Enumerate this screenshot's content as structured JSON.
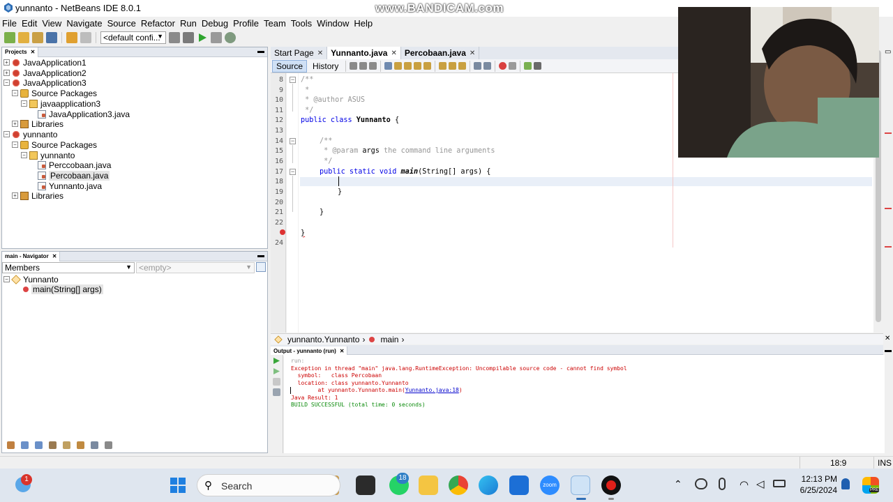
{
  "window": {
    "title": "yunnanto - NetBeans IDE 8.0.1",
    "watermark": "www.BANDICAM.com"
  },
  "menu": [
    "File",
    "Edit",
    "View",
    "Navigate",
    "Source",
    "Refactor",
    "Run",
    "Debug",
    "Profile",
    "Team",
    "Tools",
    "Window",
    "Help"
  ],
  "toolbar": {
    "config": "<default confi..."
  },
  "projects": {
    "tab": "Projects",
    "tree": [
      {
        "label": "JavaApplication1"
      },
      {
        "label": "JavaApplication2"
      },
      {
        "label": "JavaApplication3"
      },
      {
        "label": "Source Packages"
      },
      {
        "label": "javaapplication3"
      },
      {
        "label": "JavaApplication3.java"
      },
      {
        "label": "Libraries"
      },
      {
        "label": "yunnanto"
      },
      {
        "label": "Source Packages"
      },
      {
        "label": "yunnanto"
      },
      {
        "label": "Perccobaan.java"
      },
      {
        "label": "Percobaan.java"
      },
      {
        "label": "Yunnanto.java"
      },
      {
        "label": "Libraries"
      }
    ]
  },
  "navigator": {
    "tab": "main - Navigator",
    "filter": "Members",
    "empty": "<empty>",
    "class": "Yunnanto",
    "method": "main(String[] args)"
  },
  "editor": {
    "tabs": [
      "Start Page",
      "Yunnanto.java",
      "Percobaan.java"
    ],
    "source_label": "Source",
    "history_label": "History",
    "line_numbers": [
      "8",
      "9",
      "10",
      "11",
      "12",
      "13",
      "14",
      "15",
      "16",
      "17",
      "18",
      "19",
      "20",
      "21",
      "22",
      "24"
    ],
    "code": {
      "l8": "/**",
      "l9": " *",
      "l10": " * @author ASUS",
      "l11": " */",
      "l12a": "public class",
      "l12b": "Yunnanto",
      "l12c": "{",
      "l14": "/**",
      "l15a": " * @param",
      "l15b": "args",
      "l15c": "the command line arguments",
      "l16": " */",
      "l17a": "public static void",
      "l17b": "main",
      "l17c": "(String[] args) {",
      "l19": "}",
      "l21": "}",
      "l23": "}"
    }
  },
  "breadcrumb": {
    "class": "yunnanto.Yunnanto",
    "method": "main"
  },
  "output": {
    "tab": "Output - yunnanto (run)",
    "lines": {
      "run": "run:",
      "exception": "Exception in thread \"main\" java.lang.RuntimeException: Uncompilable source code - cannot find symbol",
      "symbol": "  symbol:   class Percobaan",
      "location": "  location: class yunnanto.Yunnanto",
      "at_prefix": "        at yunnanto.Yunnanto.main(",
      "at_link": "Yunnanto.java:18",
      "at_suffix": ")",
      "result": "Java Result: 1",
      "build": "BUILD SUCCESSFUL (total time: 0 seconds)"
    }
  },
  "status": {
    "position": "18:9",
    "mode": "INS"
  },
  "taskbar": {
    "search": "Search",
    "notif_badge": "1",
    "whatsapp_badge": "18",
    "zoom_label": "zoom",
    "time": "12:13 PM",
    "date": "6/25/2024",
    "pre_label": "PRE"
  },
  "colors": {
    "accent": "#2f6fb7",
    "error": "#cc0000",
    "success": "#0a8a0a"
  }
}
